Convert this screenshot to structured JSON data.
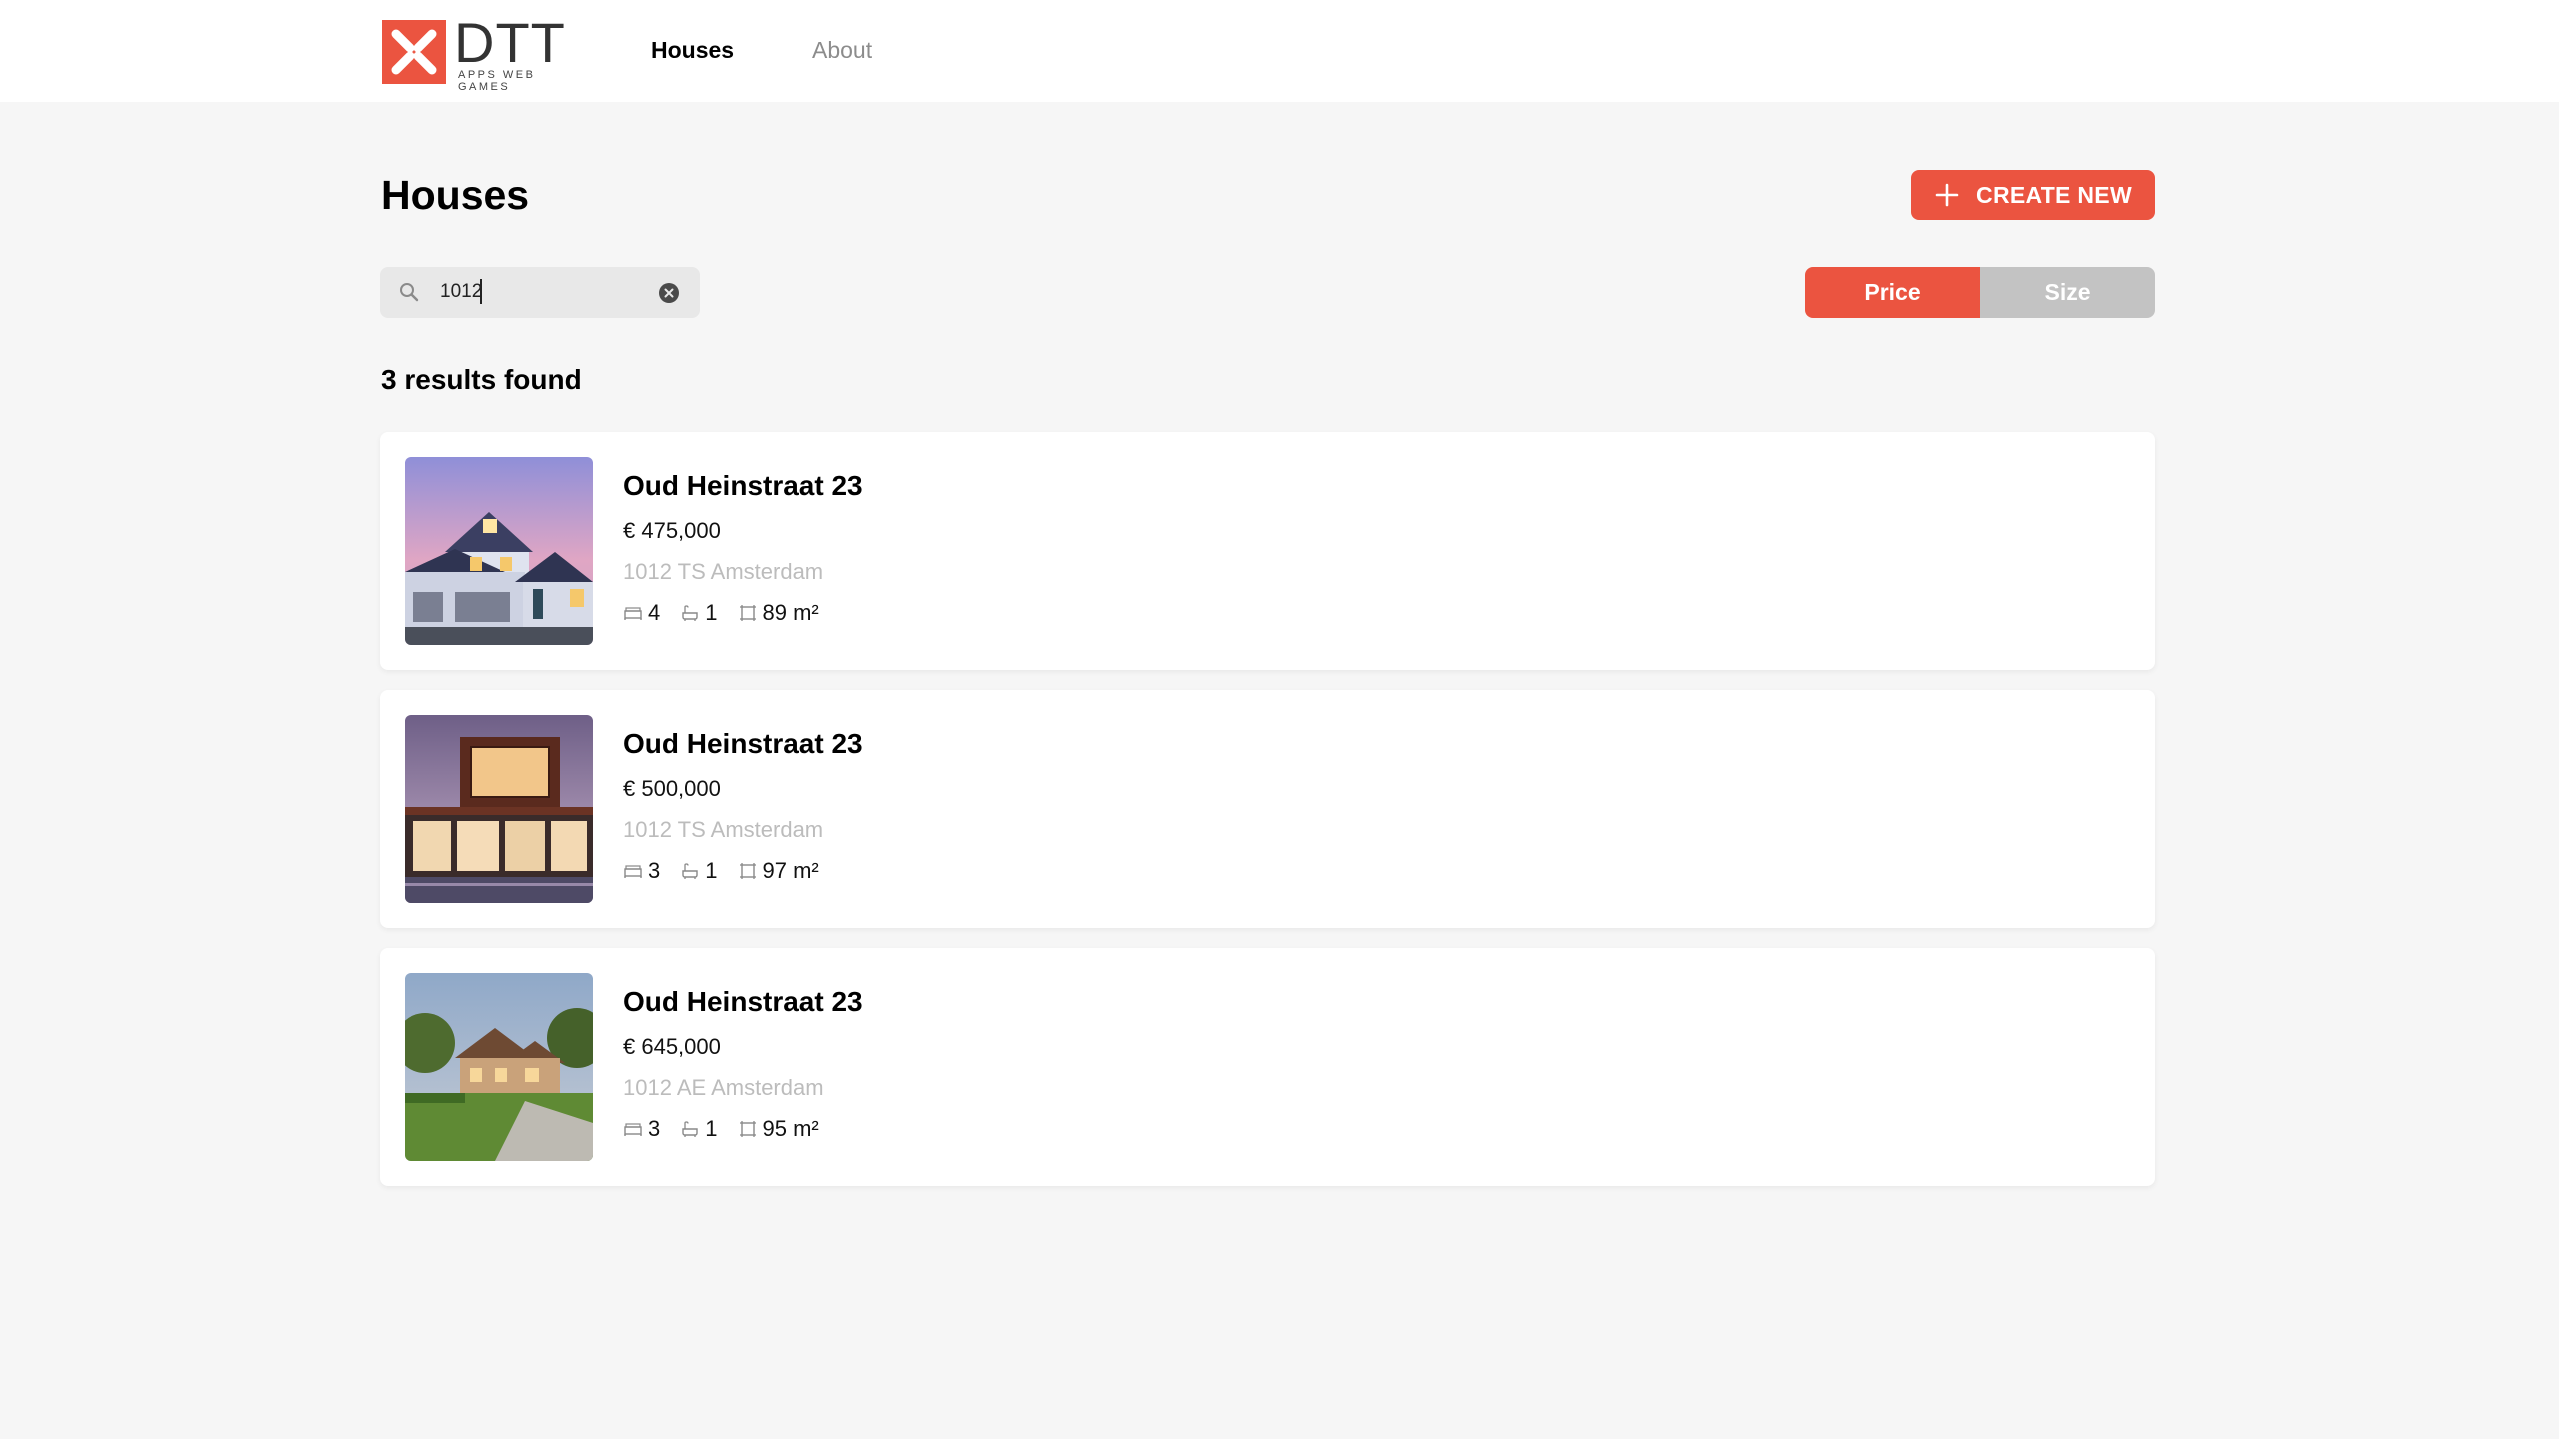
{
  "brand": {
    "wordmark": "DTT",
    "tagline": "APPS WEB GAMES",
    "accent_color": "#eb5440"
  },
  "nav": {
    "items": [
      {
        "label": "Houses",
        "active": true
      },
      {
        "label": "About",
        "active": false
      }
    ]
  },
  "page": {
    "title": "Houses",
    "create_button_label": "CREATE NEW",
    "create_button_icon": "plus-icon"
  },
  "search": {
    "value": "1012",
    "icon": "search-icon",
    "clear_icon": "clear-circle-icon"
  },
  "sort": {
    "options": [
      {
        "label": "Price",
        "active": true
      },
      {
        "label": "Size",
        "active": false
      }
    ]
  },
  "results": {
    "count_text": "3 results found"
  },
  "listings": [
    {
      "street": "Oud Heinstraat 23",
      "price": "€ 475,000",
      "postal": "1012 TS Amsterdam",
      "bedrooms": "4",
      "bathrooms": "1",
      "size": "89 m²",
      "image": "suburban-house-dusk"
    },
    {
      "street": "Oud Heinstraat 23",
      "price": "€ 500,000",
      "postal": "1012 TS Amsterdam",
      "bedrooms": "3",
      "bathrooms": "1",
      "size": "97 m²",
      "image": "modern-house-lit"
    },
    {
      "street": "Oud Heinstraat 23",
      "price": "€ 645,000",
      "postal": "1012 AE Amsterdam",
      "bedrooms": "3",
      "bathrooms": "1",
      "size": "95 m²",
      "image": "country-house-garden"
    }
  ],
  "colors": {
    "accent": "#eb5440",
    "background": "#f6f6f6",
    "muted_text": "#bcbcbc",
    "inactive_toggle": "#c3c3c3"
  }
}
